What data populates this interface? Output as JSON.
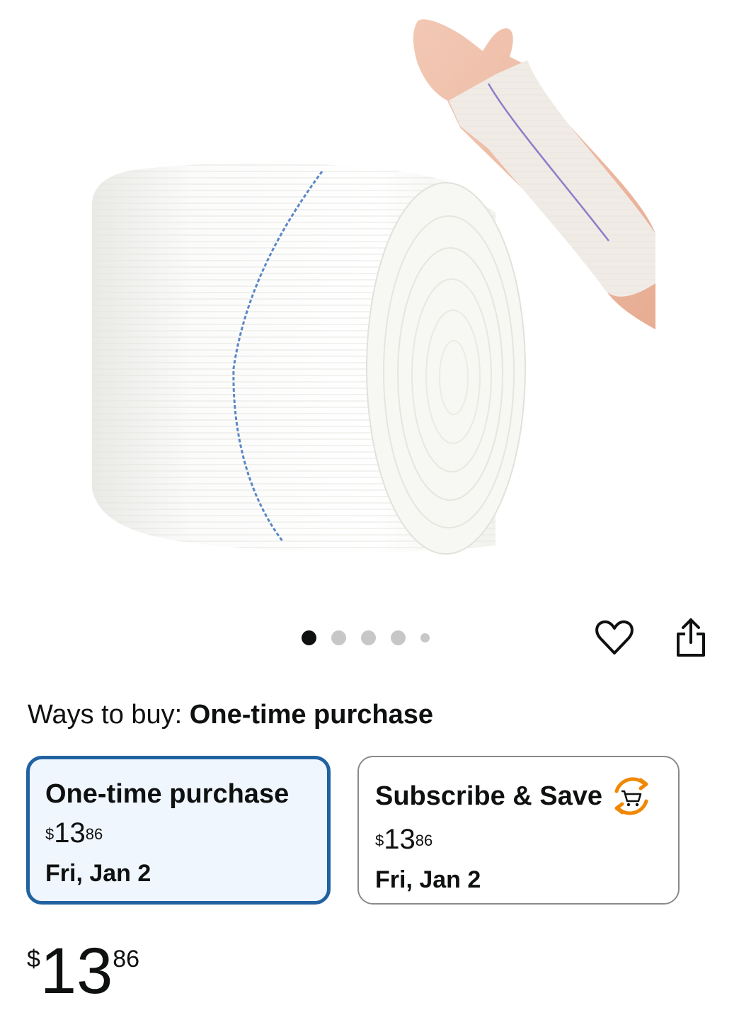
{
  "gallery": {
    "image_alt": "Tubular stockinette roll and stockinette on arm",
    "dot_count": 5,
    "active_index": 0
  },
  "actions": {
    "favorite_icon": "heart-outline-icon",
    "share_icon": "share-icon"
  },
  "ways_to_buy": {
    "label": "Ways to buy:",
    "value": "One-time purchase"
  },
  "options": [
    {
      "title": "One-time purchase",
      "currency": "$",
      "whole": "13",
      "cents": "86",
      "date": "Fri, Jan 2",
      "selected": true
    },
    {
      "title": "Subscribe & Save",
      "currency": "$",
      "whole": "13",
      "cents": "86",
      "date": "Fri, Jan 2",
      "selected": false,
      "icon": "subscribe-cart-icon"
    }
  ],
  "price": {
    "currency": "$",
    "whole": "13",
    "cents": "86"
  },
  "colors": {
    "accent_blue": "#2162a1",
    "selected_bg": "#f0f6fd",
    "subscribe_orange": "#f08804"
  }
}
